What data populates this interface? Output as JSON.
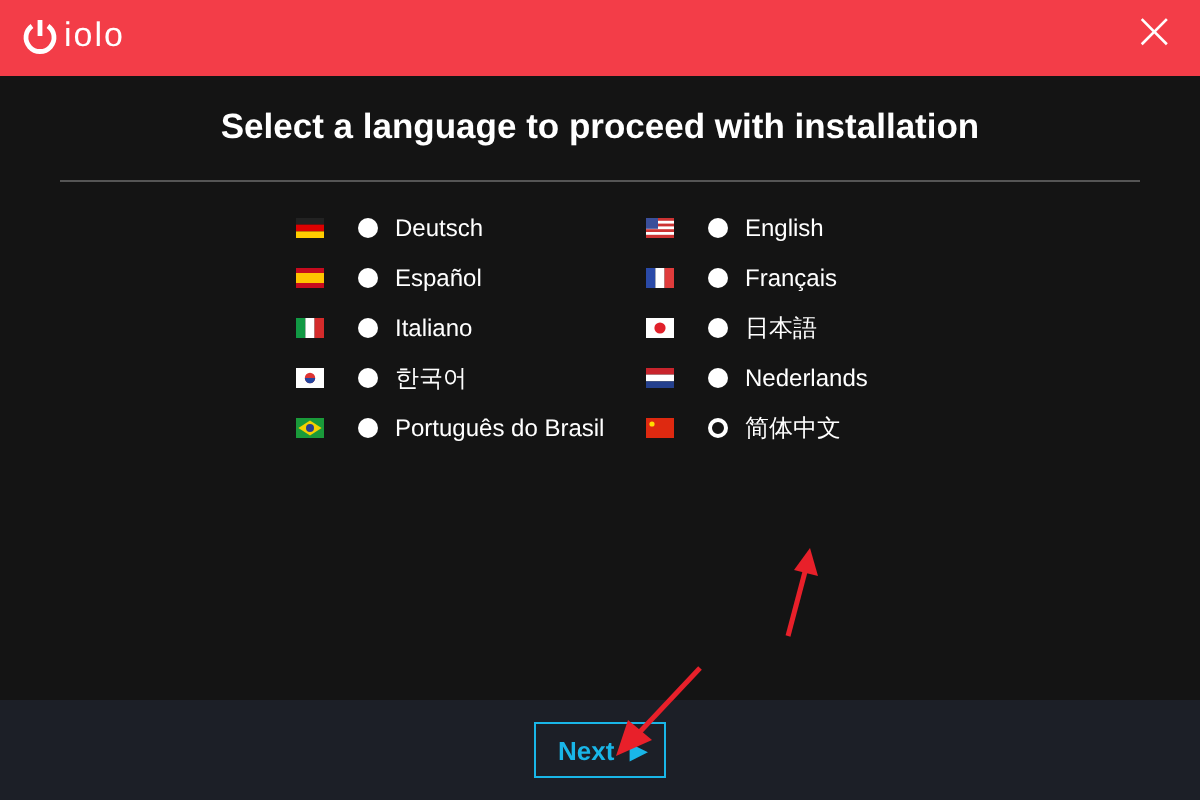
{
  "header": {
    "logo": "iolo",
    "close": "×"
  },
  "title": "Select a language to proceed with installation",
  "languages": [
    {
      "label": "Deutsch",
      "selected": false
    },
    {
      "label": "English",
      "selected": false
    },
    {
      "label": "Español",
      "selected": false
    },
    {
      "label": "Français",
      "selected": false
    },
    {
      "label": "Italiano",
      "selected": false
    },
    {
      "label": "日本語",
      "selected": false
    },
    {
      "label": "한국어",
      "selected": false
    },
    {
      "label": "Nederlands",
      "selected": false
    },
    {
      "label": "Português do Brasil",
      "selected": false
    },
    {
      "label": "简体中文",
      "selected": true
    }
  ],
  "next_button": {
    "label": "Next",
    "icon": "▶"
  }
}
